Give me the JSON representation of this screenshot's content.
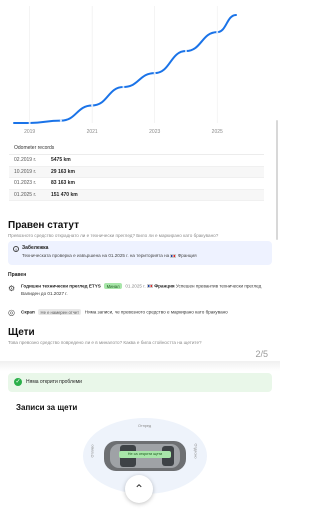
{
  "chart_data": {
    "type": "line",
    "x": [
      2018.5,
      2019,
      2020,
      2021,
      2022,
      2023,
      2024,
      2025,
      2025.6
    ],
    "values": [
      0,
      0,
      4000,
      29163,
      60000,
      83163,
      120000,
      151470,
      180000
    ],
    "xticks": [
      "2019",
      "2021",
      "2023",
      "2025"
    ],
    "xlim": [
      2018.5,
      2025.6
    ],
    "ylim": [
      0,
      185000
    ],
    "color": "#1a73e8",
    "title": "",
    "xlabel": "",
    "ylabel": ""
  },
  "odometer": {
    "title": "Odometer records",
    "rows": [
      {
        "date": "02.2019 г.",
        "value": "5475 km"
      },
      {
        "date": "10.2019 г.",
        "value": "29 163 km"
      },
      {
        "date": "01.2023 г.",
        "value": "83 163 km"
      },
      {
        "date": "01.2025 г.",
        "value": "151 470 km"
      }
    ]
  },
  "legal": {
    "title": "Правен статут",
    "subtitle": "Превозното средство откраднато ли е технически преглед? Било ли е маркирано като бракувано?",
    "note_icon": "info-icon",
    "note_title": "Забележка",
    "note_text_before": "Техническата проверка е извършена на 01.2025 г. на територията на",
    "note_country": "Франция",
    "label": "Правен",
    "inspection": {
      "icon": "wrench-icon",
      "name": "Годишен технически преглед ETYS",
      "badge": "Минал",
      "date": "01.2025 г.",
      "country": "Франция",
      "text": "Успешен превантив технически преглед",
      "valid": "Валиден до 01.2027 г."
    },
    "stolen": {
      "icon": "target-icon",
      "name": "Скрап",
      "badge": "Не е намерен отчет",
      "text": "Няма записи, че превозното средство е маркирано като бракувано"
    }
  },
  "damage": {
    "title": "Щети",
    "subtitle": "Това превозно средство повредено ли е в миналото? Каква е била стойността на щетите?",
    "page_indicator": "2/5",
    "ok_text": "Няма открити проблеми",
    "records_title": "Записи за щети",
    "car_front": "Отпред",
    "car_left": "Отляво",
    "car_right": "Отдясно",
    "car_badge": "Не са открити щети"
  },
  "fab_icon": "chevron-up-icon",
  "colors": {
    "accent": "#1a73e8",
    "success": "#2bb04a",
    "badge_green": "#a8e6a9",
    "note_bg": "#eef2ff"
  }
}
